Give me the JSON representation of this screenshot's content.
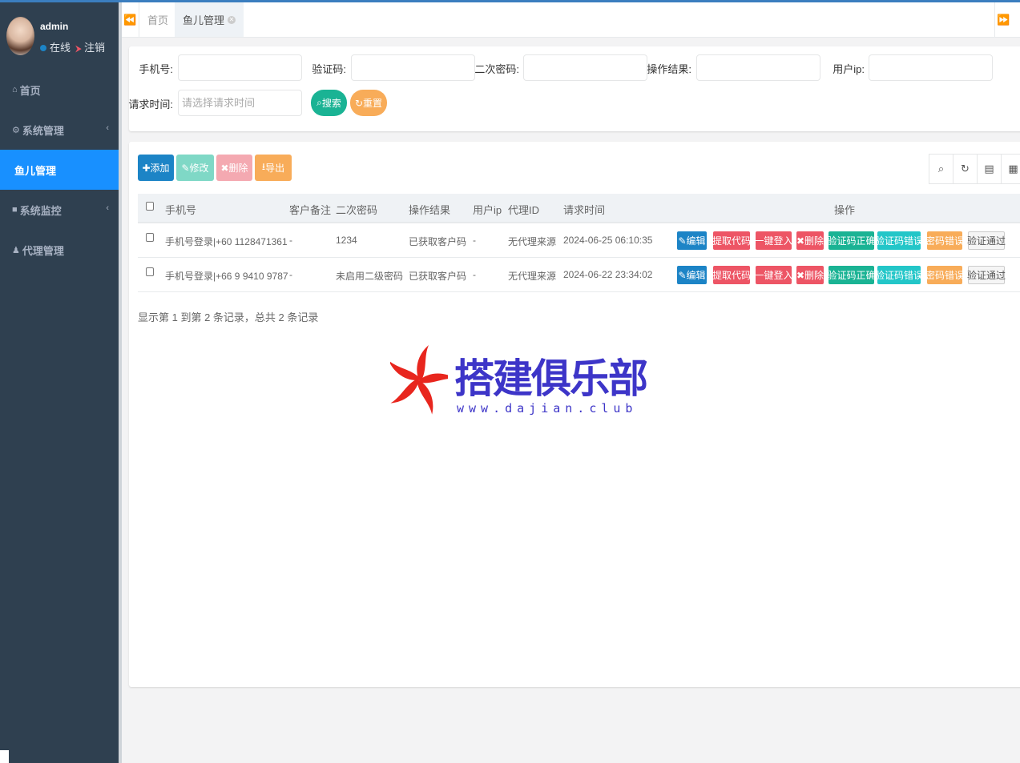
{
  "user": {
    "name": "admin",
    "status": "在线",
    "logout": "注销"
  },
  "nav": [
    {
      "label": "首页",
      "icon": "home-icon"
    },
    {
      "label": "系统管理",
      "icon": "gear-icon"
    },
    {
      "label": "鱼儿管理",
      "active": true
    },
    {
      "label": "系统监控",
      "icon": "video-icon"
    },
    {
      "label": "代理管理",
      "icon": "user-icon"
    }
  ],
  "tabs": [
    {
      "label": "首页"
    },
    {
      "label": "鱼儿管理"
    }
  ],
  "search": {
    "phone_label": "手机号:",
    "code_label": "验证码:",
    "second_pwd_label": "二次密码:",
    "result_label": "操作结果:",
    "ip_label": "用户ip:",
    "time_label": "请求时间:",
    "time_placeholder": "请选择请求时间",
    "search_button": "搜索",
    "reset_button": "重置"
  },
  "toolbar": {
    "add": "添加",
    "edit": "修改",
    "delete": "删除",
    "export": "导出"
  },
  "table": {
    "columns": [
      "手机号",
      "客户备注",
      "二次密码",
      "操作结果",
      "用户ip",
      "代理ID",
      "请求时间",
      "操作"
    ],
    "rows": [
      {
        "phone": "手机号登录|+60 1128471361",
        "remark": "-",
        "second_pwd": "1234",
        "result": "已获取客户码",
        "ip": "-",
        "agent": "无代理来源",
        "time": "2024-06-25 06:10:35"
      },
      {
        "phone": "手机号登录|+66 9 9410 9787",
        "remark": "-",
        "second_pwd": "未启用二级密码",
        "result": "已获取客户码",
        "ip": "-",
        "agent": "无代理来源",
        "time": "2024-06-22 23:34:02"
      }
    ],
    "actions": [
      "编辑",
      "提取代码",
      "一键登入",
      "删除",
      "验证码正确",
      "验证码错误",
      "密码错误",
      "验证通过"
    ]
  },
  "pager": {
    "info": "显示第 1 到第 2 条记录，总共 2 条记录"
  },
  "watermark": {
    "name": "搭建俱乐部",
    "url": "www.dajian.club"
  },
  "colors": {
    "primary": "#1c84c6",
    "active_nav": "#1890ff",
    "sidebar": "#2f4050",
    "danger": "#ed5565",
    "success": "#1ab394",
    "info": "#23c6c8",
    "warning": "#f8ac59"
  }
}
